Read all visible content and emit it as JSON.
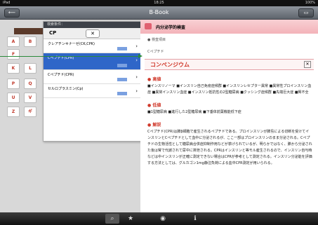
{
  "status": {
    "carrier": "iPad",
    "time": "18:25",
    "battery": "100%"
  },
  "nav": {
    "title": "B-Book",
    "left_btn": "⟵",
    "right_btn": "▭"
  },
  "list": {
    "header": "検索条件：",
    "query": "CP",
    "clear": "✕",
    "rows": [
      {
        "text": "クレアチンキナーゼ(CK,CPK)",
        "selected": false
      },
      {
        "text": "Cペプチド(CPR)",
        "selected": true
      },
      {
        "text": "Cペプチド(CPR)",
        "selected": false
      },
      {
        "text": "セルロプラスミン(Cp)",
        "selected": false
      }
    ]
  },
  "alphabet": [
    "A",
    "B",
    "F",
    "K",
    "L",
    "P",
    "Q",
    "U",
    "V",
    "Z",
    "ギ"
  ],
  "detail": {
    "banner": "内分泌学的検査",
    "entry_label": "● 検査項目",
    "entry_value": "Cペプチド",
    "term": "コンペンジウム",
    "sections": [
      {
        "h": "● 高値",
        "b": "■インスリノーマ ■インスリン自己免疫症候群 ■インスリンレセプター異常 ■異常性プロインスリン血症 ■異常インスリン血症 ■インスリン抵抗性の2型糖尿病 ■クッシング症候群 ■先端巨大症 ■腎不全"
      },
      {
        "h": "● 低値",
        "b": "■1型糖尿病 ■進行した2型糖尿病 ■下垂体前葉機能低下症"
      },
      {
        "h": "● 解説",
        "b": "Cペプチド(CPR)は膵β細胞で産生されるペプチドである。プロインスリンが膵島による切断を受けてインスリンとCペプチドとして血中に分泌されるが、ここ一部はプロインスリンのまま分泌される。Cペプチドの生物活性として糖尿病合併症抑制作用などが挙げられているが、明らかではなく、膵から分泌された後は腎で代謝されて尿中に排泄される。CPRはインスリンと等モル産生されるので、インスリン自与時などは中インスリンが正確に測定できない場合はCPRが参考として測定される。インスリン分泌能を評価する方法としては、グルカゴン1mg静注負荷による血中CPR測定が用いられる。"
      }
    ]
  },
  "tabs": [
    {
      "icon": "⌕",
      "active": true
    },
    {
      "icon": "★",
      "active": false
    },
    {
      "icon": "◉",
      "active": false
    },
    {
      "icon": "ℹ",
      "active": false
    }
  ]
}
